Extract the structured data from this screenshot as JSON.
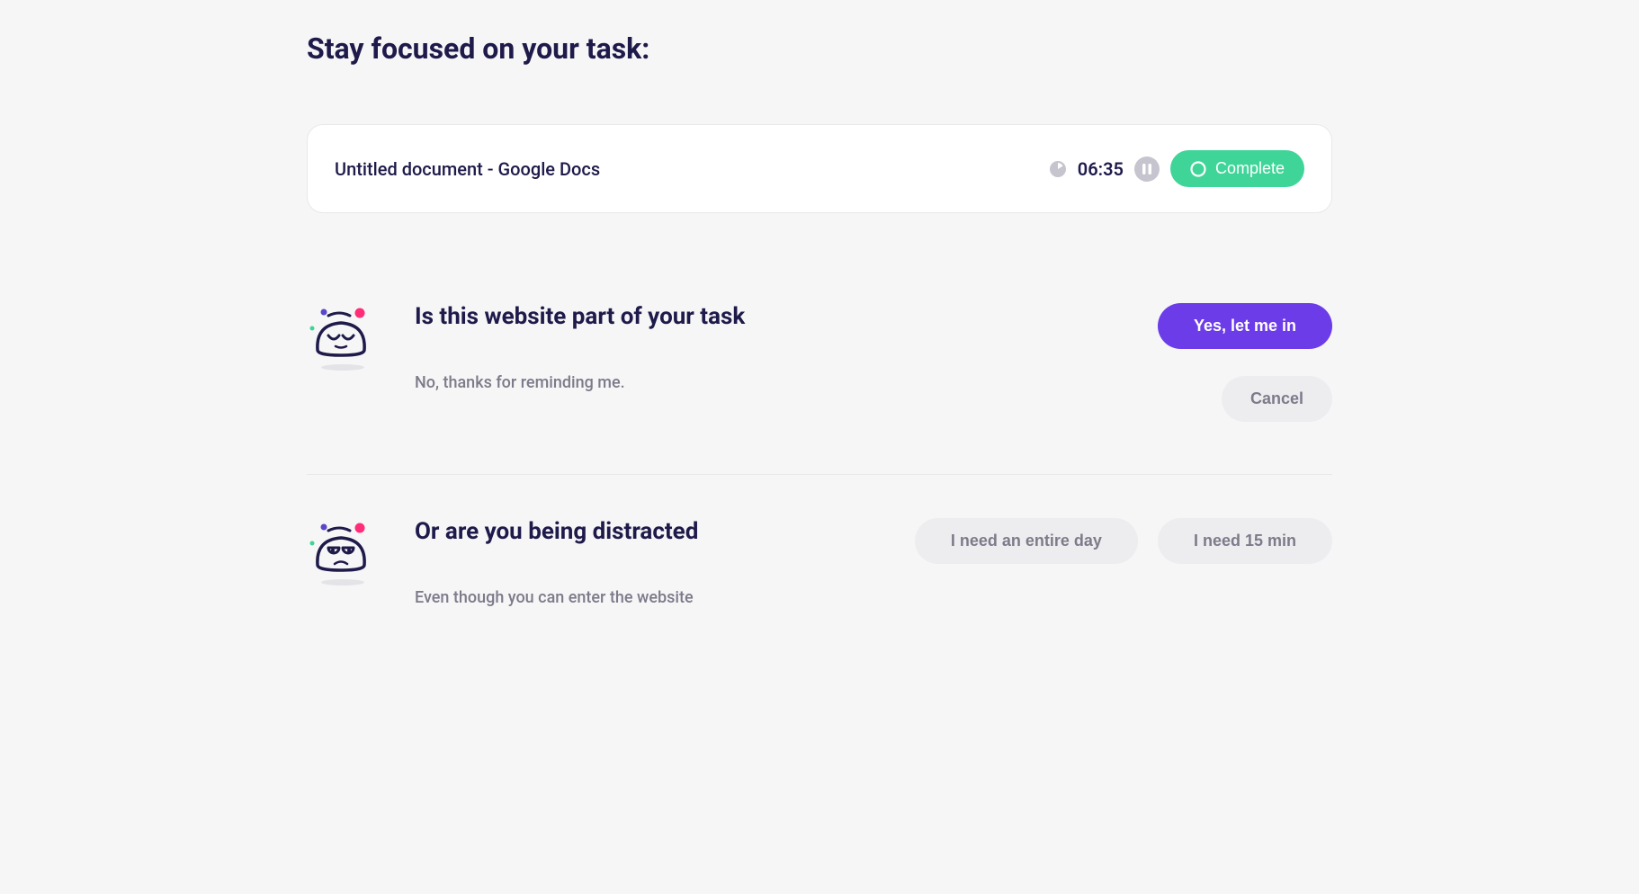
{
  "page": {
    "title": "Stay focused on your task:"
  },
  "task": {
    "title": "Untitled document - Google Docs",
    "time": "06:35",
    "complete_label": "Complete"
  },
  "section1": {
    "heading": "Is this website part of your task",
    "sub": "No, thanks for reminding me.",
    "yes_label": "Yes, let me in",
    "cancel_label": "Cancel"
  },
  "section2": {
    "heading": "Or are you being distracted",
    "sub": "Even though you can enter the website",
    "day_label": "I need an entire day",
    "min15_label": "I need 15 min"
  }
}
